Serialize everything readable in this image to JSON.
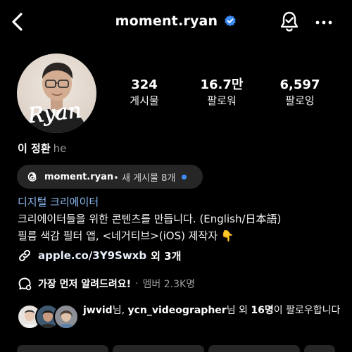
{
  "header": {
    "username": "moment.ryan",
    "verified": true,
    "back_icon": "chevron-left-icon",
    "bell_icon": "bell-icon",
    "more_icon": "more-horizontal-icon"
  },
  "profile": {
    "avatar_signature": "Ryan",
    "name": "이 정환",
    "pronouns": "he"
  },
  "stats": [
    {
      "value": "324",
      "label": "게시물"
    },
    {
      "value": "16.7만",
      "label": "팔로워"
    },
    {
      "value": "6,597",
      "label": "팔로잉"
    }
  ],
  "threads": {
    "handle": "moment.ryan",
    "suffix": " • 새 게시물 8개"
  },
  "bio": {
    "category": "디지털 크리에이터",
    "line1": "크리에이터들을 위한 콘텐츠를 만듭니다. (English/日本語)",
    "line2": "필름 색감 필터 앱, <네거티브>(iOS) 제작자 👇"
  },
  "link": {
    "url": "apple.co/3Y9Swxb",
    "extra": "외 3개"
  },
  "broadcast": {
    "text": "가장 먼저 알려드려요!",
    "separator": "·",
    "members": "멤버 2.3K명"
  },
  "mutual": {
    "name1": "jwvid",
    "t1": "님, ",
    "name2": "ycn_videographer",
    "t2": "님 외 ",
    "count": "16명",
    "t3": "이 팔로우합니다"
  },
  "colors": {
    "background": "#000000",
    "accent_blue": "#3d8cf5",
    "category_blue": "#8ab8f0",
    "chip_bg": "#262626"
  }
}
